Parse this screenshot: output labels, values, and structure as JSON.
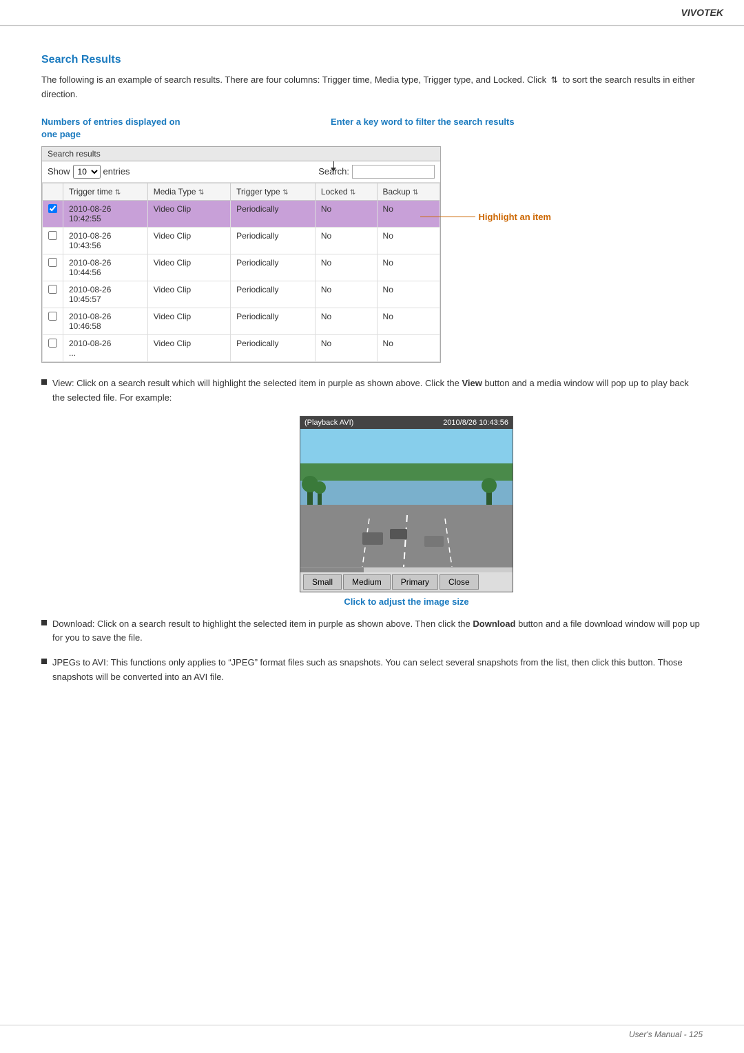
{
  "header": {
    "brand": "VIVOTEK"
  },
  "page": {
    "section_title": "Search Results",
    "intro_text": "The following is an example of search results. There are four columns: Trigger time, Media type, Trigger type, and Locked. Click",
    "intro_text2": "to sort the search results in either direction.",
    "annotation_left_label": "Numbers of entries displayed on one page",
    "annotation_right_label": "Enter a key word to filter the search results",
    "highlight_label": "Highlight an item"
  },
  "search_results": {
    "title": "Search results",
    "show_label": "Show",
    "show_value": "10",
    "entries_label": "entries",
    "search_label": "Search:",
    "search_placeholder": "",
    "columns": [
      "",
      "Trigger time",
      "Media Type",
      "Trigger type",
      "Locked",
      "Backup"
    ],
    "rows": [
      {
        "highlighted": true,
        "time": "2010-08-26\n10:42:55",
        "media": "Video Clip",
        "trigger": "Periodically",
        "locked": "No",
        "backup": "No"
      },
      {
        "highlighted": false,
        "time": "2010-08-26\n10:43:56",
        "media": "Video Clip",
        "trigger": "Periodically",
        "locked": "No",
        "backup": "No"
      },
      {
        "highlighted": false,
        "time": "2010-08-26\n10:44:56",
        "media": "Video Clip",
        "trigger": "Periodically",
        "locked": "No",
        "backup": "No"
      },
      {
        "highlighted": false,
        "time": "2010-08-26\n10:45:57",
        "media": "Video Clip",
        "trigger": "Periodically",
        "locked": "No",
        "backup": "No"
      },
      {
        "highlighted": false,
        "time": "2010-08-26\n10:46:58",
        "media": "Video Clip",
        "trigger": "Periodically",
        "locked": "No",
        "backup": "No"
      },
      {
        "highlighted": false,
        "time": "2010-08-26\n...",
        "media": "Video Clip",
        "trigger": "Periodically",
        "locked": "No",
        "backup": "No"
      }
    ]
  },
  "playback": {
    "title": "(Playback AVI)",
    "timestamp": "2010/8/26 10:43:56",
    "buttons": [
      "Small",
      "Medium",
      "Primary",
      "Close"
    ],
    "click_label": "Click to adjust the image size"
  },
  "bullets": [
    {
      "id": "view",
      "text_parts": [
        {
          "bold": false,
          "text": "View: Click on a search result which will highlight the selected item in purple as shown above. Click the "
        },
        {
          "bold": true,
          "text": "View"
        },
        {
          "bold": false,
          "text": " button and a media window will pop up to play back the selected file. For example:"
        }
      ]
    },
    {
      "id": "download",
      "text_parts": [
        {
          "bold": false,
          "text": "Download: Click on a search result to highlight the selected item in purple as shown above. Then click the "
        },
        {
          "bold": true,
          "text": "Download"
        },
        {
          "bold": false,
          "text": " button and a file download window will pop up for you to save the file."
        }
      ]
    },
    {
      "id": "jpegs",
      "text_parts": [
        {
          "bold": false,
          "text": "JPEGs to AVI: This functions only applies to “JPEG” format files such as snapshots. You can select several snapshots from the list, then click this button. Those snapshots will be converted into an AVI file."
        }
      ]
    }
  ],
  "footer": {
    "text": "User's Manual - 125"
  }
}
